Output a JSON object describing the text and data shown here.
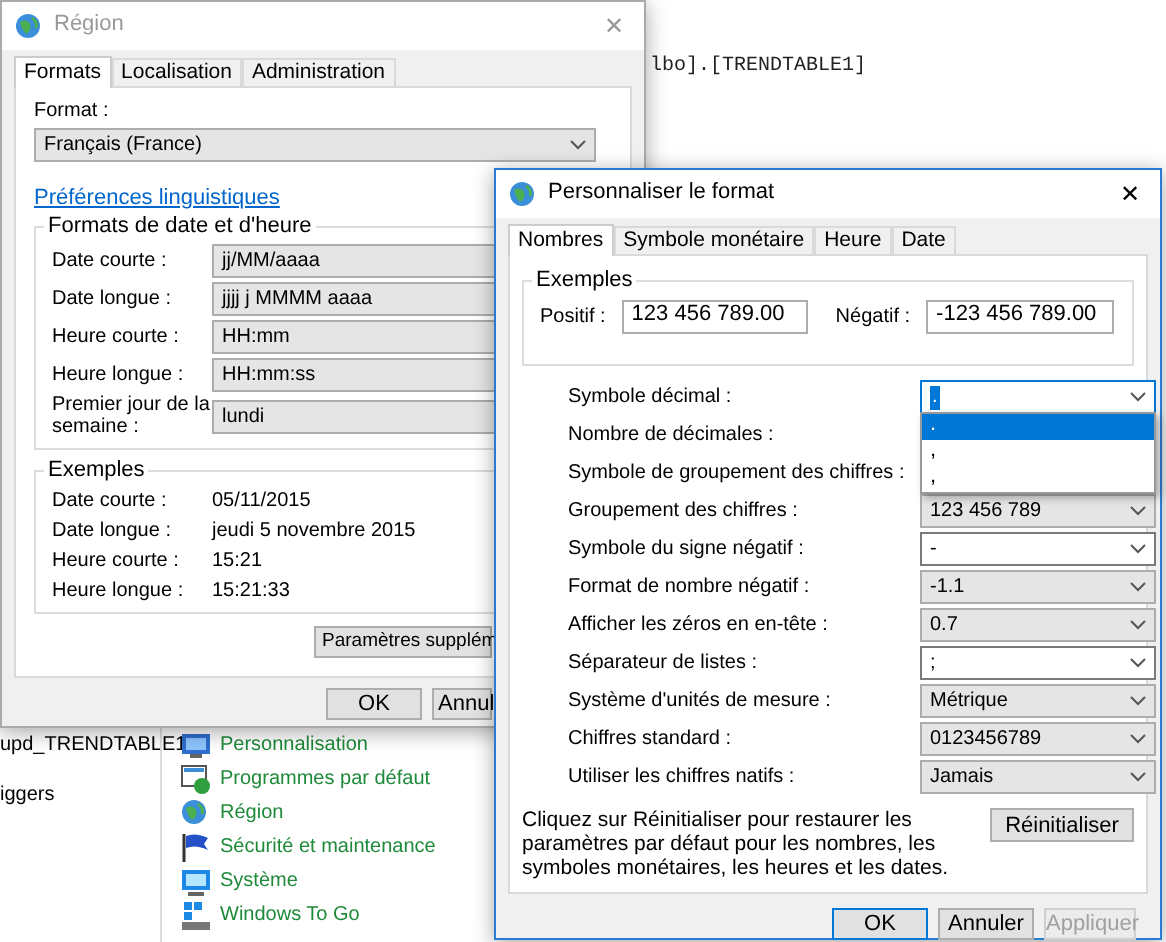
{
  "background": {
    "code_line": "lbo].[TRENDTABLE1]",
    "left_items": [
      "upd_TRENDTABLE1",
      "iggers"
    ],
    "control_panel_items": [
      {
        "label": "Personnalisation"
      },
      {
        "label": "Programmes par défaut"
      },
      {
        "label": "Région"
      },
      {
        "label": "Sécurité et maintenance"
      },
      {
        "label": "Système"
      },
      {
        "label": "Windows To Go"
      }
    ]
  },
  "region_window": {
    "title": "Région",
    "close": "✕",
    "tabs": [
      {
        "label": "Formats",
        "selected": true
      },
      {
        "label": "Localisation",
        "selected": false
      },
      {
        "label": "Administration",
        "selected": false
      }
    ],
    "format_label": "Format :",
    "format_value": "Français (France)",
    "link": "Préférences linguistiques",
    "date_group": {
      "title": "Formats de date et d'heure",
      "rows": [
        {
          "label": "Date courte :",
          "value": "jj/MM/aaaa"
        },
        {
          "label": "Date longue :",
          "value": "jjjj j MMMM aaaa"
        },
        {
          "label": "Heure courte :",
          "value": "HH:mm"
        },
        {
          "label": "Heure longue :",
          "value": "HH:mm:ss"
        },
        {
          "label": "Premier jour de la semaine :",
          "value": "lundi"
        }
      ]
    },
    "examples": {
      "title": "Exemples",
      "rows": [
        {
          "label": "Date courte :",
          "value": "05/11/2015"
        },
        {
          "label": "Date longue :",
          "value": "jeudi 5 novembre 2015"
        },
        {
          "label": "Heure courte :",
          "value": "15:21"
        },
        {
          "label": "Heure longue :",
          "value": "15:21:33"
        }
      ]
    },
    "more_button": "Paramètres supplém",
    "buttons": [
      "OK",
      "Annul"
    ]
  },
  "format_window": {
    "title": "Personnaliser le format",
    "close": "✕",
    "tabs": [
      {
        "label": "Nombres",
        "selected": true
      },
      {
        "label": "Symbole monétaire",
        "selected": false
      },
      {
        "label": "Heure",
        "selected": false
      },
      {
        "label": "Date",
        "selected": false
      }
    ],
    "examples": {
      "title": "Exemples",
      "positive_label": "Positif :",
      "positive_value": "123 456 789.00",
      "negative_label": "Négatif :",
      "negative_value": "-123 456 789.00"
    },
    "settings": [
      {
        "label": "Symbole décimal :",
        "kind": "editable",
        "value": ".",
        "expanded": true,
        "options": [
          {
            "label": ".",
            "selected": true
          },
          {
            "label": ",",
            "selected": false
          },
          {
            "label": ",",
            "selected": false
          }
        ]
      },
      {
        "label": "Nombre de décimales :",
        "kind": "list"
      },
      {
        "label": "Symbole de groupement des chiffres :",
        "kind": "editable"
      },
      {
        "label": "Groupement des chiffres :",
        "kind": "list",
        "value": "123 456 789"
      },
      {
        "label": "Symbole du signe négatif :",
        "kind": "editable",
        "value": "-"
      },
      {
        "label": "Format de nombre négatif :",
        "kind": "list",
        "value": "-1.1"
      },
      {
        "label": "Afficher les zéros en en-tête :",
        "kind": "list",
        "value": "0.7"
      },
      {
        "label": "Séparateur de listes :",
        "kind": "editable",
        "value": ";"
      },
      {
        "label": "Système d'unités de mesure :",
        "kind": "list",
        "value": "Métrique"
      },
      {
        "label": "Chiffres standard :",
        "kind": "list",
        "value": "0123456789"
      },
      {
        "label": "Utiliser les chiffres natifs :",
        "kind": "list",
        "value": "Jamais"
      }
    ],
    "reset_text": "Cliquez sur Réinitialiser pour restaurer les paramètres par défaut pour les nombres, les symboles monétaires, les heures et les dates.",
    "reset_button": "Réinitialiser",
    "buttons": [
      {
        "label": "OK",
        "disabled": false
      },
      {
        "label": "Annuler",
        "disabled": false
      },
      {
        "label": "Appliquer",
        "disabled": true
      }
    ]
  }
}
